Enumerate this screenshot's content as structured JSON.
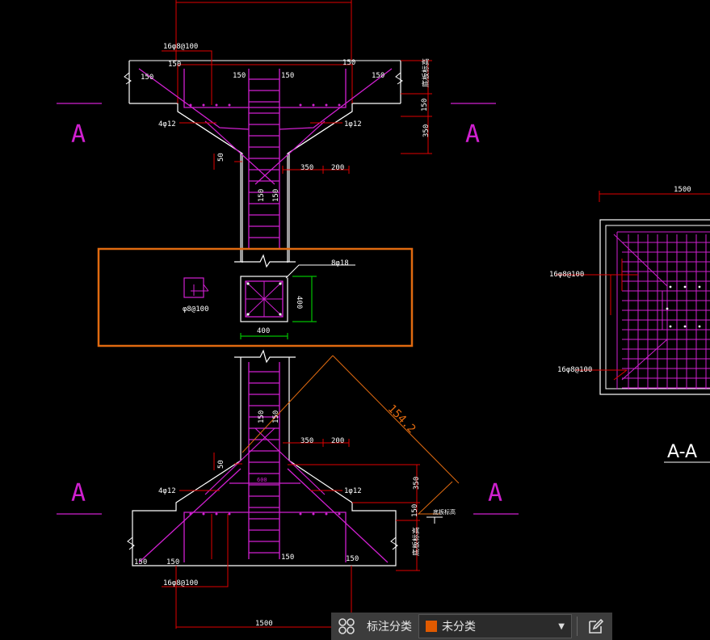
{
  "drawing": {
    "section_mark": "A",
    "section_title": "A-A",
    "labels": {
      "rebar_16_top": "16φ8@100",
      "rebar_16_bottom": "16φ8@100",
      "rebar_16_right1": "16φ8@100",
      "rebar_16_right2": "16φ8@100",
      "rebar_4_top": "4φ12",
      "rebar_1_top": "1φ12",
      "rebar_4_bot": "4φ12",
      "rebar_1_bot": "1φ12",
      "rebar_8": "8φ18",
      "stirrup": "φ8@100",
      "elev_top": "底板标高",
      "elev_bot": "底板标高",
      "elev_mid": "底板标高",
      "gap_text": "600"
    },
    "dims": {
      "d150": "150",
      "d350": "350",
      "d200": "200",
      "d50": "50",
      "d400": "400",
      "d1500": "1500",
      "aligned": "154.2"
    }
  },
  "colors": {
    "accent_box": "#e06a10",
    "magenta": "#d020d0",
    "dim_red": "#e00000",
    "swatch": "#e05a00"
  },
  "statusbar": {
    "group_icon": "grid-icon",
    "label": "标注分类",
    "selected": "未分类",
    "edit_icon": "edit-icon"
  }
}
